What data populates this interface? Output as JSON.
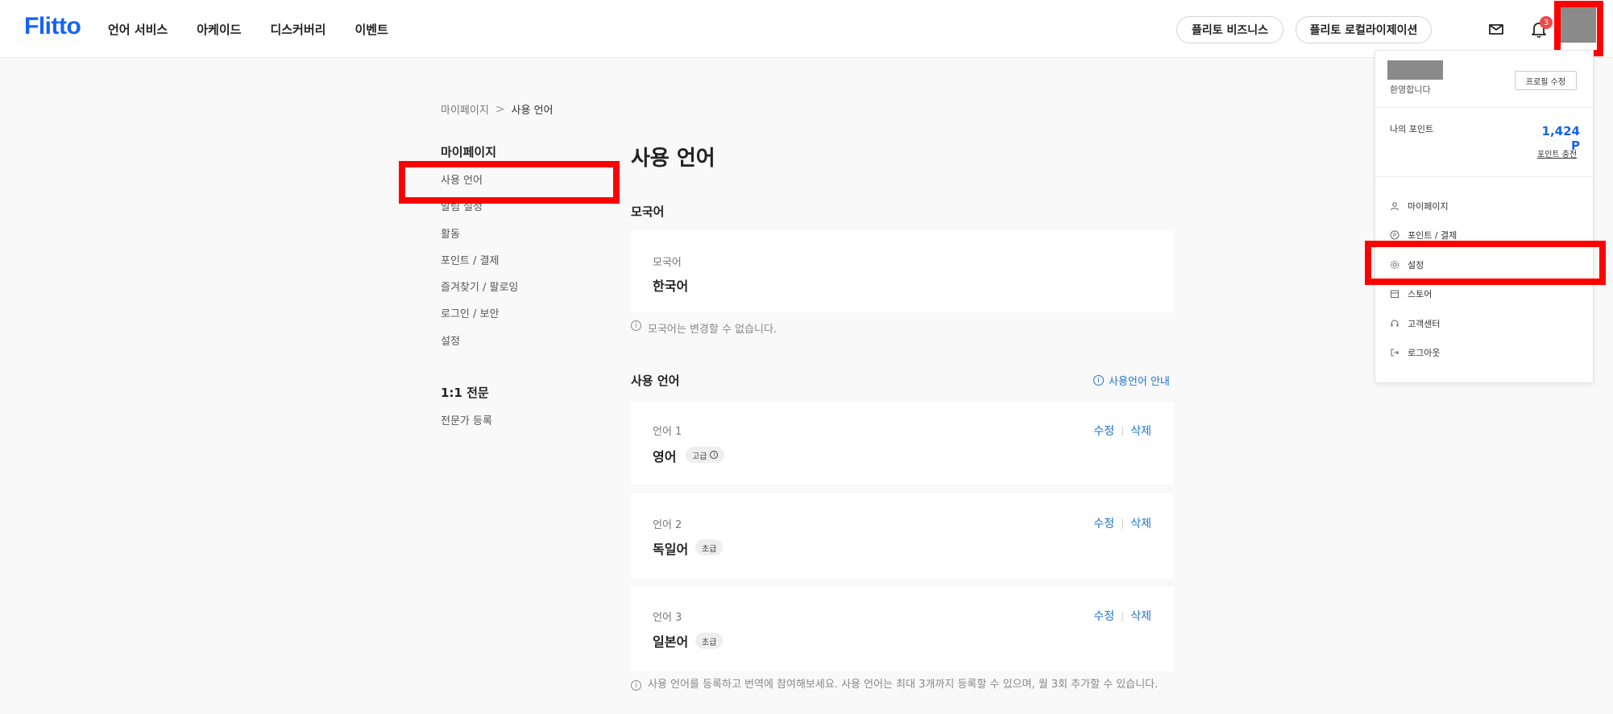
{
  "header": {
    "logo": "Flitto",
    "nav": [
      "언어 서비스",
      "아케이드",
      "디스커버리",
      "이벤트"
    ],
    "business_button": "플리토 비즈니스",
    "localization_button": "플리토 로컬라이제이션",
    "notification_count": "3"
  },
  "breadcrumb": {
    "root": "마이페이지",
    "sep": ">",
    "current": "사용 언어"
  },
  "sidebar": {
    "section1_title": "마이페이지",
    "items": [
      "사용 언어",
      "알림 설정",
      "활동",
      "포인트 / 결제",
      "즐겨찾기 / 팔로잉",
      "로그인 / 보안",
      "설정"
    ],
    "section2_title": "1:1 전문",
    "items2": [
      "전문가 등록"
    ]
  },
  "main": {
    "title": "사용 언어",
    "native_section": "모국어",
    "native_label": "모국어",
    "native_value": "한국어",
    "native_note": "모국어는 변경할 수 없습니다.",
    "used_section": "사용 언어",
    "info_link": "사용언어 안내",
    "edit_label": "수정",
    "delete_label": "삭제",
    "divider": "|",
    "languages": [
      {
        "label": "언어 1",
        "name": "영어",
        "level": "고급"
      },
      {
        "label": "언어 2",
        "name": "독일어",
        "level": "초급"
      },
      {
        "label": "언어 3",
        "name": "일본어",
        "level": "초급"
      }
    ],
    "bottom_note": "사용 언어를 등록하고 번역에 참여해보세요. 사용 언어는 최대 3개까지 등록할 수 있으며, 월 3회 추가할 수 있습니다."
  },
  "dropdown": {
    "welcome": "환영합니다",
    "edit_profile": "프로필 수정",
    "points_label": "나의 포인트",
    "points_value": "1,424 P",
    "charge": "포인트 충전",
    "menu": [
      {
        "icon": "user-icon",
        "label": "마이페이지"
      },
      {
        "icon": "point-icon",
        "label": "포인트 / 결제"
      },
      {
        "icon": "gear-icon",
        "label": "설정"
      },
      {
        "icon": "store-icon",
        "label": "스토어"
      },
      {
        "icon": "headset-icon",
        "label": "고객센터"
      },
      {
        "icon": "logout-icon",
        "label": "로그아웃"
      }
    ]
  },
  "colors": {
    "brand": "#1464f6",
    "link": "#1e74d6",
    "highlight": "#ff0000",
    "badge": "#f04848"
  }
}
